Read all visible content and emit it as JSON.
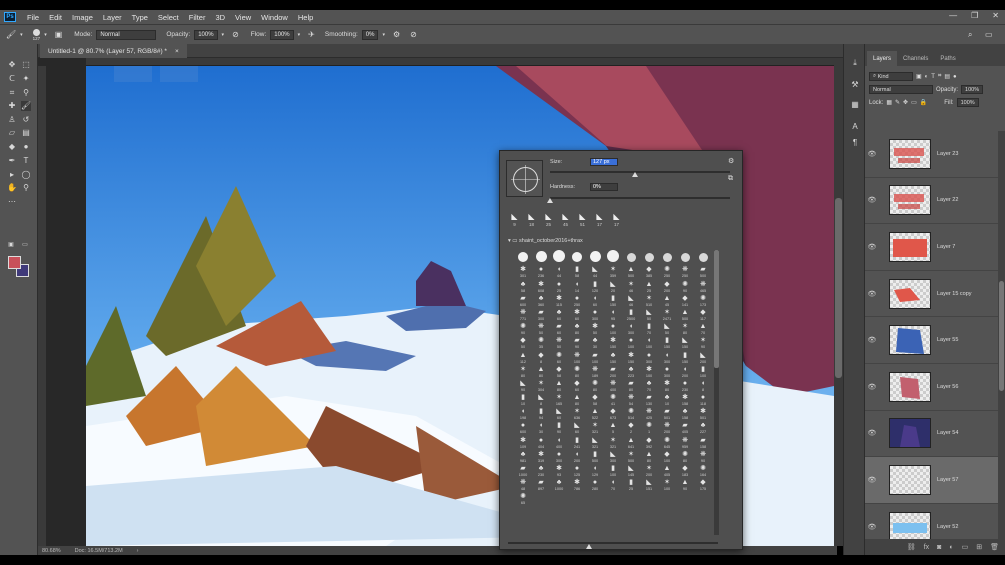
{
  "app": {
    "name": "Photoshop",
    "logo": "Ps"
  },
  "menu": [
    "File",
    "Edit",
    "Image",
    "Layer",
    "Type",
    "Select",
    "Filter",
    "3D",
    "View",
    "Window",
    "Help"
  ],
  "window_controls": [
    "minimize",
    "restore",
    "close"
  ],
  "options": {
    "brush_size": "127",
    "mode_label": "Mode:",
    "mode_value": "Normal",
    "opacity_label": "Opacity:",
    "opacity_value": "100%",
    "flow_label": "Flow:",
    "flow_value": "100%",
    "smoothing_label": "Smoothing:",
    "smoothing_value": "0%"
  },
  "document_tab": {
    "title": "Untitled-1 @ 80.7% (Layer 57, RGB/8#) *",
    "close": "×"
  },
  "status": {
    "zoom": "80.68%",
    "doc": "Doc: 16.5M/713.2M"
  },
  "colors": {
    "foreground": "#c8505a",
    "background": "#403a7a",
    "accent": "#31a8ff",
    "size_highlight": "#3a6fd8"
  },
  "brush_panel": {
    "size_label": "Size:",
    "size_value": "127 px",
    "size_fraction": 0.47,
    "hardness_label": "Hardness:",
    "hardness_value": "0%",
    "hardness_fraction": 0.0,
    "recent_brushes": [
      "9",
      "18",
      "25",
      "45",
      "51",
      "17",
      "17"
    ],
    "folder_name": "shaint_october2016+thrax",
    "brush_sizes": [
      "",
      "",
      "",
      "",
      "",
      "",
      "",
      "",
      "",
      "",
      "",
      "301",
      "236",
      "44",
      "58",
      "44",
      "359",
      "500",
      "385",
      "250",
      "250",
      "500",
      "58",
      "608",
      "25",
      "14",
      "120",
      "20",
      "46",
      "25",
      "200",
      "90",
      "465",
      "600",
      "360",
      "115",
      "250",
      "60",
      "150",
      "46",
      "510",
      "45",
      "141",
      "173",
      "771",
      "300",
      "60",
      "60",
      "300",
      "95",
      "2500",
      "50",
      "2471",
      "500",
      "117",
      "90",
      "50",
      "60",
      "80",
      "50",
      "100",
      "300",
      "70",
      "50",
      "80",
      "70",
      "50",
      "35",
      "50",
      "90",
      "30",
      "150",
      "100",
      "100",
      "150",
      "150",
      "90",
      "112",
      "8",
      "60",
      "100",
      "100",
      "150",
      "150",
      "300",
      "300",
      "150",
      "200",
      "80",
      "80",
      "58",
      "80",
      "189",
      "200",
      "223",
      "100",
      "300",
      "200",
      "100",
      "90",
      "304",
      "80",
      "60",
      "80",
      "400",
      "80",
      "70",
      "80",
      "230",
      "8",
      "10",
      "8",
      "165",
      "80",
      "58",
      "41",
      "54",
      "130",
      "10",
      "158",
      "118",
      "198",
      "94",
      "60",
      "636",
      "522",
      "673",
      "514",
      "425",
      "501",
      "158",
      "501",
      "600",
      "30",
      "90",
      "60",
      "321",
      "5",
      "2",
      "1",
      "200",
      "405",
      "227",
      "109",
      "404",
      "400",
      "241",
      "321",
      "321",
      "641",
      "392",
      "645",
      "959",
      "158",
      "981",
      "319",
      "300",
      "200",
      "500",
      "300",
      "500",
      "80",
      "100",
      "80",
      "90",
      "1000",
      "230",
      "93",
      "125",
      "129",
      "100",
      "145",
      "200",
      "405",
      "183",
      "164",
      "48",
      "897",
      "1000",
      "786",
      "280",
      "70",
      "25",
      "151",
      "100",
      "90",
      "175",
      "65"
    ]
  },
  "layers_panel": {
    "tabs": [
      "Layers",
      "Channels",
      "Paths"
    ],
    "filter_kind": "Kind",
    "blend_mode": "Normal",
    "opacity_label": "Opacity:",
    "opacity_value": "100%",
    "lock_label": "Lock:",
    "fill_label": "Fill:",
    "fill_value": "100%",
    "layers": [
      {
        "name": "Layer 23",
        "thumb": "redstrokes",
        "selected": false
      },
      {
        "name": "Layer 22",
        "thumb": "redstrokes",
        "selected": false
      },
      {
        "name": "Layer 7",
        "thumb": "red",
        "selected": false
      },
      {
        "name": "Layer 15 copy",
        "thumb": "redsmall",
        "selected": false
      },
      {
        "name": "Layer 55",
        "thumb": "blue",
        "selected": false
      },
      {
        "name": "Layer 56",
        "thumb": "pink",
        "selected": false
      },
      {
        "name": "Layer 54",
        "thumb": "figure",
        "selected": false
      },
      {
        "name": "Layer 57",
        "thumb": "empty",
        "selected": true
      },
      {
        "name": "Layer 52",
        "thumb": "lightblue",
        "selected": false
      }
    ]
  }
}
